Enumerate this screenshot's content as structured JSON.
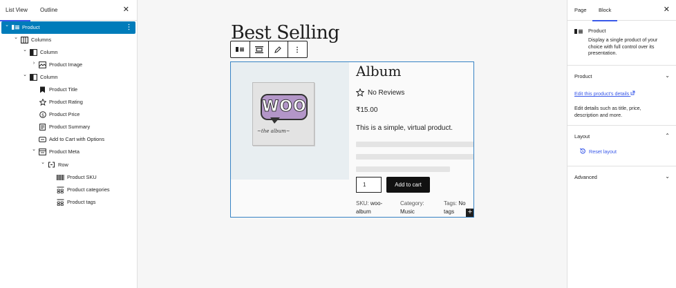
{
  "left_panel": {
    "tabs": [
      "List View",
      "Outline"
    ],
    "close": "✕",
    "tree": [
      {
        "label": "Product",
        "chevron": "⌄",
        "icon": "product-icon",
        "selected": true
      },
      {
        "label": "Columns",
        "chevron": "⌄",
        "icon": "columns-icon"
      },
      {
        "label": "Column",
        "chevron": "⌄",
        "icon": "column-icon"
      },
      {
        "label": "Product Image",
        "chevron": "›",
        "icon": "image-icon"
      },
      {
        "label": "Column",
        "chevron": "⌄",
        "icon": "column-icon"
      },
      {
        "label": "Product Title",
        "chevron": "",
        "icon": "bookmark-icon"
      },
      {
        "label": "Product Rating",
        "chevron": "",
        "icon": "star-icon"
      },
      {
        "label": "Product Price",
        "chevron": "",
        "icon": "price-icon"
      },
      {
        "label": "Product Summary",
        "chevron": "",
        "icon": "summary-icon"
      },
      {
        "label": "Add to Cart with Options",
        "chevron": "",
        "icon": "button-icon"
      },
      {
        "label": "Product Meta",
        "chevron": "⌄",
        "icon": "meta-icon"
      },
      {
        "label": "Row",
        "chevron": "⌄",
        "icon": "row-icon"
      },
      {
        "label": "Product SKU",
        "chevron": "",
        "icon": "barcode-icon"
      },
      {
        "label": "Product categories",
        "chevron": "",
        "icon": "terms-icon"
      },
      {
        "label": "Product tags",
        "chevron": "",
        "icon": "terms-icon"
      }
    ]
  },
  "canvas": {
    "heading": "Best Selling",
    "product": {
      "title": "Album",
      "rating": "No Reviews",
      "price": "₹15.00",
      "summary": "This is a simple, virtual product.",
      "quantity": "1",
      "add_to_cart": "Add to cart",
      "image_logo": "WOO",
      "image_caption": "the album",
      "sku_label": "SKU:",
      "sku_line1": "woo-",
      "sku_line2": "album",
      "category_label": "Category:",
      "category_value": "Music",
      "tags_label": "Tags:",
      "tags_line1": "No",
      "tags_line2": "tags",
      "plus": "+"
    }
  },
  "right_panel": {
    "tabs": [
      "Page",
      "Block"
    ],
    "close": "✕",
    "block_title": "Product",
    "block_description": "Display a single product of your choice with full control over its presentation.",
    "sections": {
      "product": "Product",
      "layout": "Layout",
      "advanced": "Advanced"
    },
    "edit_link": "Edit this product's details",
    "edit_desc": "Edit details such as title, price, description and more.",
    "reset_layout": "Reset layout"
  },
  "colors": {
    "accent": "#3858e9",
    "selected": "#007cba",
    "block_border": "#3582c4"
  }
}
